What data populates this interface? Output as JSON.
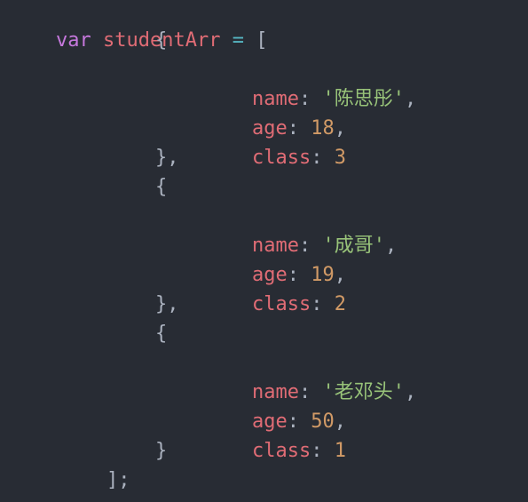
{
  "colors": {
    "background": "#282c34",
    "keyword": "#c678dd",
    "variable": "#e06c75",
    "operator": "#56b6c2",
    "punctuation": "#abb2bf",
    "property": "#e06c75",
    "string": "#98c379",
    "number": "#d19a66"
  },
  "code": {
    "decl": {
      "keyword": "var",
      "name": "studentArr",
      "assign": "=",
      "open": "["
    },
    "students": [
      {
        "name": "'陈思彤'",
        "age": "18",
        "class": "3"
      },
      {
        "name": "'成哥'",
        "age": "19",
        "class": "2"
      },
      {
        "name": "'老邓头'",
        "age": "50",
        "class": "1"
      }
    ],
    "keys": {
      "name": "name",
      "age": "age",
      "class": "class"
    },
    "tokens": {
      "brace_open": "{",
      "brace_close": "}",
      "brace_close_comma": "},",
      "colon": ":",
      "comma": ",",
      "close": "];"
    }
  }
}
